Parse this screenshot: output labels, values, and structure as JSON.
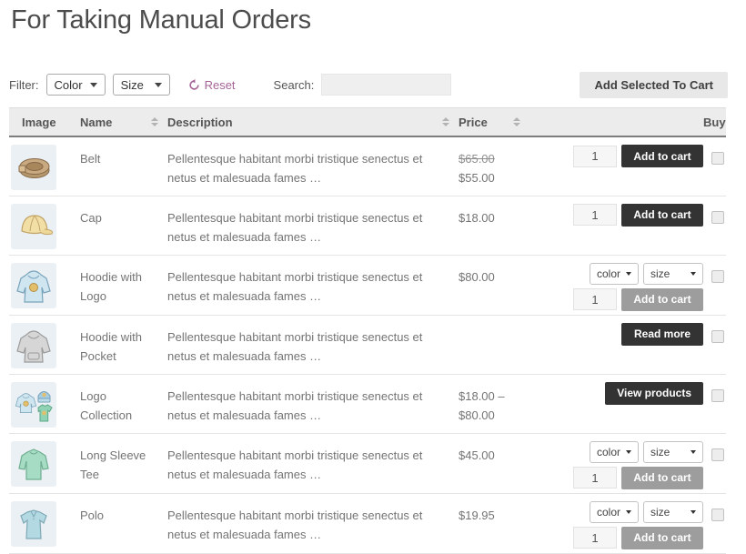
{
  "title": "For Taking Manual Orders",
  "colors": {
    "accent_purple": "#a46497",
    "button_dark": "#333333",
    "button_disabled": "#9d9d9d",
    "header_bg": "#ececec",
    "thumb_bg": "#eaf0f4"
  },
  "icons": {
    "reset": "rotate-ccw-icon",
    "sort": "sort-arrows-icon",
    "select_caret": "chevron-down-icon"
  },
  "toolbar": {
    "filter_label": "Filter:",
    "filters": [
      {
        "name": "color-filter",
        "value": "Color"
      },
      {
        "name": "size-filter",
        "value": "Size"
      }
    ],
    "reset_label": "Reset",
    "search_label": "Search:",
    "search_value": "",
    "add_selected_label": "Add Selected To Cart"
  },
  "table": {
    "headers": [
      {
        "label": "Image",
        "sortable": false
      },
      {
        "label": "Name",
        "sortable": true
      },
      {
        "label": "Description",
        "sortable": true
      },
      {
        "label": "Price",
        "sortable": true
      },
      {
        "label": "",
        "sortable": false
      },
      {
        "label": "Buy",
        "sortable": false
      }
    ],
    "rows": [
      {
        "image": "belt",
        "name": "Belt",
        "description": "Pellentesque habitant morbi tristique senectus et netus et malesuada fames …",
        "price_del": "$65.00",
        "price": "$55.00",
        "control": "simple",
        "qty": "1",
        "button": "Add to cart"
      },
      {
        "image": "cap",
        "name": "Cap",
        "description": "Pellentesque habitant morbi tristique senectus et netus et malesuada fames …",
        "price": "$18.00",
        "control": "simple",
        "qty": "1",
        "button": "Add to cart"
      },
      {
        "image": "hoodie-logo",
        "name": "Hoodie with Logo",
        "description": "Pellentesque habitant morbi tristique senectus et netus et malesuada fames …",
        "price": "$80.00",
        "control": "variable",
        "options": [
          "color",
          "size"
        ],
        "qty": "1",
        "button": "Add to cart"
      },
      {
        "image": "hoodie-pocket",
        "name": "Hoodie with Pocket",
        "description": "Pellentesque habitant morbi tristique senectus et netus et malesuada fames …",
        "control": "button",
        "button": "Read more"
      },
      {
        "image": "logo-collection",
        "name": "Logo Collection",
        "description": "Pellentesque habitant morbi tristique senectus et netus et malesuada fames …",
        "price": "$18.00 –",
        "price2": "$80.00",
        "control": "button",
        "button": "View products"
      },
      {
        "image": "long-sleeve-tee",
        "name": "Long Sleeve Tee",
        "description": "Pellentesque habitant morbi tristique senectus et netus et malesuada fames …",
        "price": "$45.00",
        "control": "variable",
        "options": [
          "color",
          "size"
        ],
        "qty": "1",
        "button": "Add to cart"
      },
      {
        "image": "polo",
        "name": "Polo",
        "description": "Pellentesque habitant morbi tristique senectus et netus et malesuada fames …",
        "price": "$19.95",
        "control": "variable",
        "options": [
          "color",
          "size"
        ],
        "qty": "1",
        "button": "Add to cart"
      }
    ]
  }
}
